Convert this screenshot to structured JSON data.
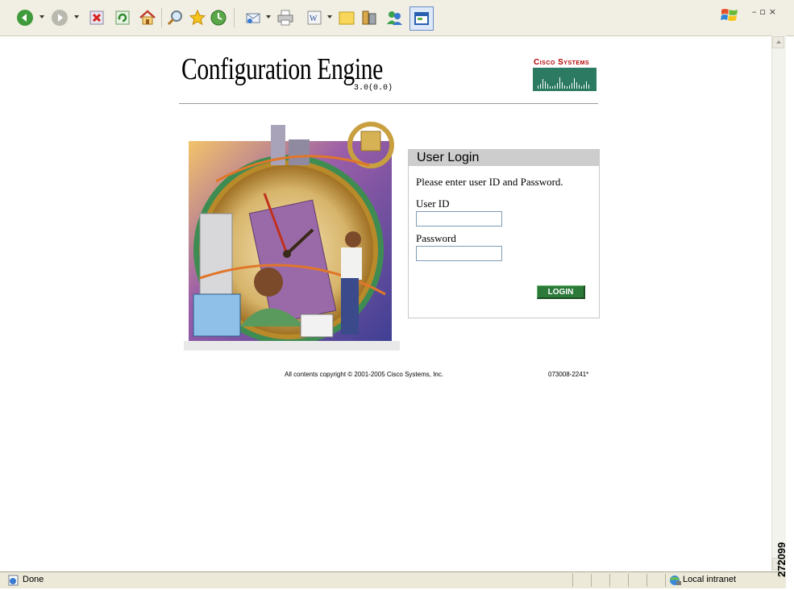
{
  "toolbar": {
    "icons": [
      "back-icon",
      "forward-icon",
      "stop-icon",
      "refresh-icon",
      "home-icon",
      "search-icon",
      "favorites-icon",
      "history-icon",
      "mail-icon",
      "print-icon",
      "edit-icon",
      "notes-icon",
      "research-icon",
      "messenger-icon",
      "window-icon"
    ]
  },
  "page": {
    "title": "Configuration Engine",
    "version": "3.0(0.0)",
    "brand": "Cisco Systems"
  },
  "login": {
    "header": "User Login",
    "instruction": "Please enter user ID and Password.",
    "userid_label": "User ID",
    "userid_value": "",
    "password_label": "Password",
    "password_value": "",
    "button_label": "LOGIN"
  },
  "footer": {
    "copyright": "All contents copyright © 2001-2005 Cisco Systems, Inc.",
    "build_id": "073008-2241*"
  },
  "statusbar": {
    "status": "Done",
    "zone": "Local intranet"
  },
  "figure_id": "272099",
  "colors": {
    "login_button": "#2b7a3a",
    "brand_red": "#b30000",
    "logo_green": "#2c7a62",
    "login_header_bg": "#cdcdcd"
  }
}
